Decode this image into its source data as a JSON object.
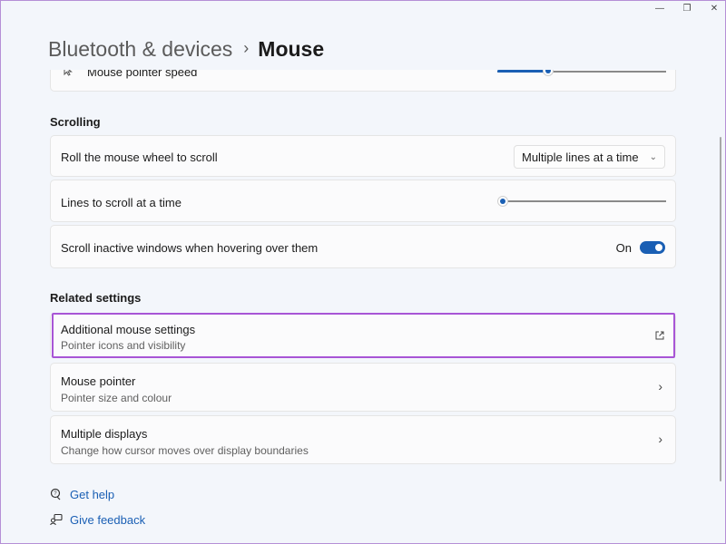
{
  "breadcrumb": {
    "parent": "Bluetooth & devices",
    "separator": "›",
    "current": "Mouse"
  },
  "pointer_speed": {
    "label": "Mouse pointer speed",
    "value": 0.3
  },
  "scrolling": {
    "title": "Scrolling",
    "roll_label": "Roll the mouse wheel to scroll",
    "roll_value": "Multiple lines at a time",
    "lines_label": "Lines to scroll at a time",
    "lines_value": 0.0,
    "inactive_label": "Scroll inactive windows when hovering over them",
    "inactive_state": "On"
  },
  "related": {
    "title": "Related settings",
    "items": [
      {
        "title": "Additional mouse settings",
        "subtitle": "Pointer icons and visibility"
      },
      {
        "title": "Mouse pointer",
        "subtitle": "Pointer size and colour"
      },
      {
        "title": "Multiple displays",
        "subtitle": "Change how cursor moves over display boundaries"
      }
    ]
  },
  "links": {
    "help": "Get help",
    "feedback": "Give feedback"
  },
  "window_controls": {
    "minimize": "—",
    "restore": "❐",
    "close": "✕"
  },
  "colors": {
    "accent": "#1a5fb4",
    "highlight": "#a855d6"
  },
  "icons": {
    "pointer": "mouse-pointer-icon",
    "external": "open-external-icon",
    "chevron": "chevron-right-icon",
    "help": "help-icon",
    "feedback": "feedback-icon"
  }
}
